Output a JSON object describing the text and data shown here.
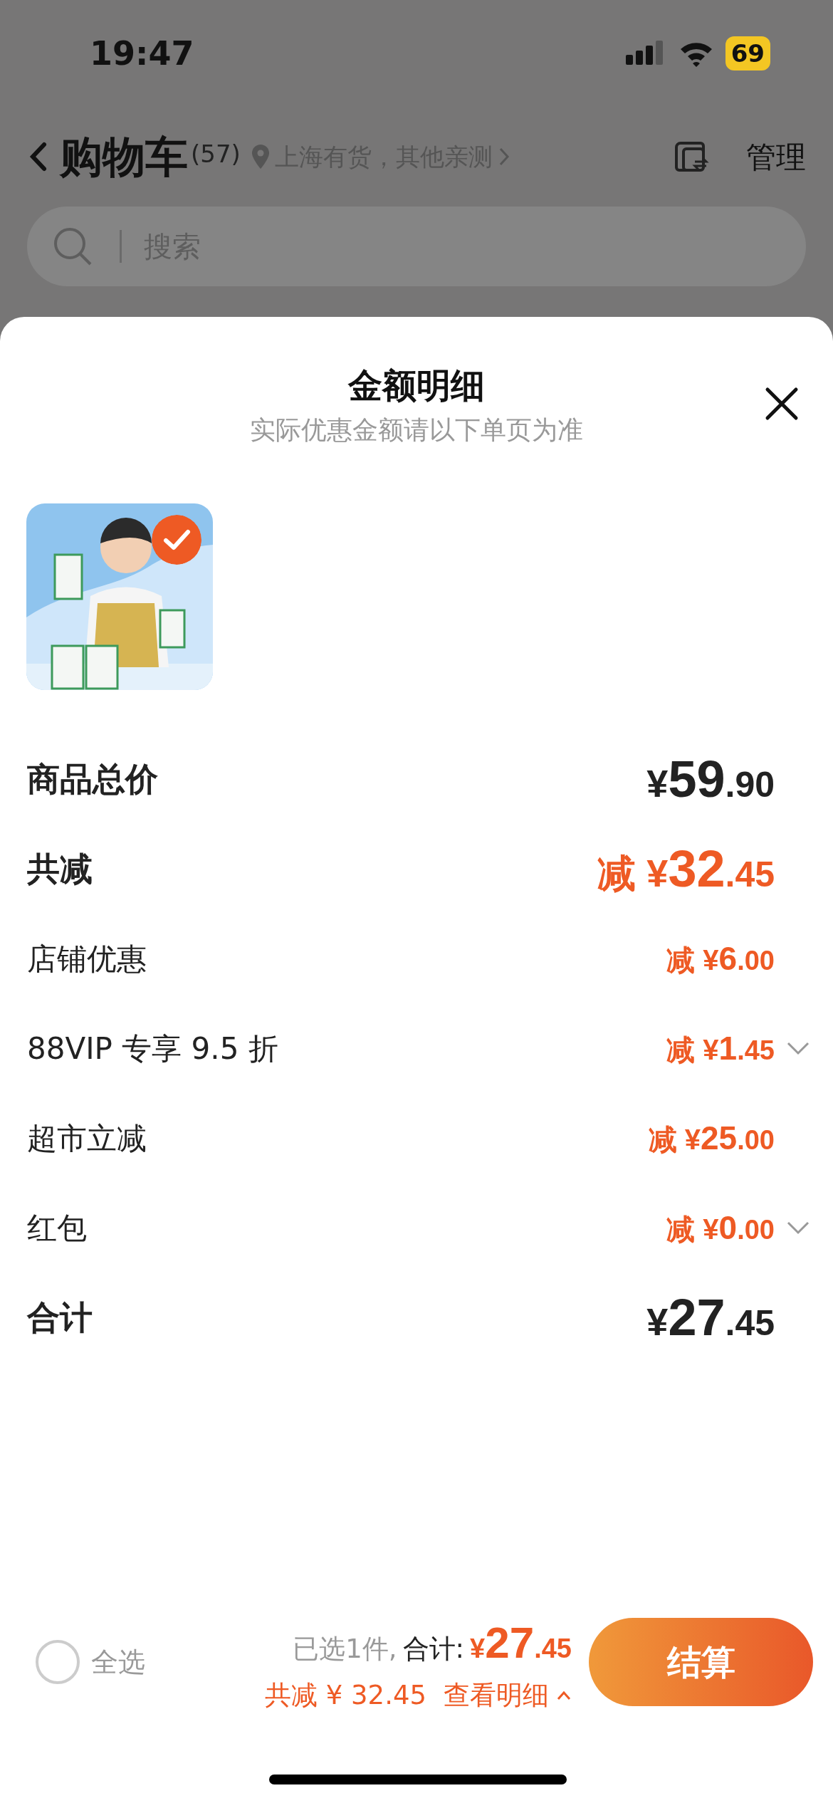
{
  "status_bar": {
    "time": "19:47",
    "battery": "69"
  },
  "header": {
    "title": "购物车",
    "count": "(57)",
    "location": "上海有货，其他亲测",
    "manage": "管理"
  },
  "search": {
    "placeholder": "搜索"
  },
  "sheet": {
    "title": "金额明细",
    "subtitle": "实际优惠金额请以下单页为准",
    "products": [
      {
        "kind": "picture",
        "selected": true
      }
    ],
    "rows": [
      {
        "kind": "total",
        "label": "商品总价",
        "prefix": "",
        "currency": "¥",
        "integer": "59",
        "decimal": ".90",
        "highlight": false,
        "expandable": false
      },
      {
        "kind": "total",
        "label": "共减",
        "prefix": "减",
        "currency": "¥",
        "integer": "32",
        "decimal": ".45",
        "highlight": true,
        "expandable": false
      },
      {
        "kind": "item",
        "label": "店铺优惠",
        "prefix": "减",
        "currency": "¥",
        "integer": "6",
        "decimal": ".00",
        "highlight": true,
        "expandable": false
      },
      {
        "kind": "item",
        "label": "88VIP 专享 9.5 折",
        "prefix": "减",
        "currency": "¥",
        "integer": "1",
        "decimal": ".45",
        "highlight": true,
        "expandable": true
      },
      {
        "kind": "item",
        "label": "超市立减",
        "prefix": "减",
        "currency": "¥",
        "integer": "25",
        "decimal": ".00",
        "highlight": true,
        "expandable": false
      },
      {
        "kind": "item",
        "label": "红包",
        "prefix": "减",
        "currency": "¥",
        "integer": "0",
        "decimal": ".00",
        "highlight": true,
        "expandable": true
      },
      {
        "kind": "total",
        "label": "合计",
        "prefix": "",
        "currency": "¥",
        "integer": "27",
        "decimal": ".45",
        "highlight": false,
        "expandable": false
      }
    ]
  },
  "footer": {
    "select_all": {
      "label": "全选",
      "checked": false
    },
    "selected_count": "已选1件,",
    "total_label": "合计:",
    "total": {
      "currency": "¥",
      "integer": "27",
      "decimal": ".45"
    },
    "savings": "共减 ¥ 32.45",
    "details_link": "查看明细",
    "checkout": "结算"
  }
}
